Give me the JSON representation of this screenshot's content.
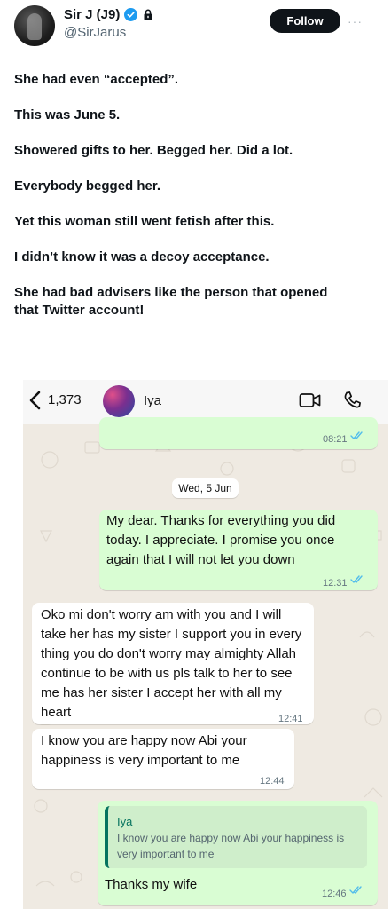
{
  "tweet": {
    "display_name": "Sir J (J9)",
    "handle": "@SirJarus",
    "follow_label": "Follow",
    "more_label": "···",
    "lines": [
      "She had even “accepted”.",
      "This was June 5.",
      "Showered gifts to her. Begged her. Did a lot.",
      "Everybody begged her.",
      "Yet this woman still went fetish after this.",
      "I didn’t know it was a decoy acceptance.",
      "She had bad advisers like the person that opened that Twitter account!"
    ]
  },
  "chat": {
    "back_count": "1,373",
    "contact_name": "Iya",
    "date_separator": "Wed, 5 Jun",
    "messages": [
      {
        "direction": "out",
        "text": "",
        "time": "08:21",
        "read": true
      },
      {
        "direction": "out",
        "text": "My dear. Thanks for everything you did today. I appreciate. I promise you once again that I will not let you down",
        "time": "12:31",
        "read": true
      },
      {
        "direction": "in",
        "text": "Oko mi don't worry am with you and I will take her has my sister I support you in every thing you do don't worry may almighty Allah continue to be with us pls talk to her to see me has her sister I accept her with all my heart",
        "time": "12:41"
      },
      {
        "direction": "in",
        "text": "I know you are happy now Abi your happiness is very important to me",
        "time": "12:44"
      },
      {
        "direction": "out",
        "quote_name": "Iya",
        "quote_text": "I know you are happy now Abi your happiness is very important to me",
        "text": "Thanks my wife",
        "time": "12:46",
        "read": true
      }
    ]
  },
  "colors": {
    "tweet_text": "#0f1419",
    "handle": "#536471",
    "verified_badge": "#1d9bf0",
    "chat_background": "#efeae2",
    "outgoing_bubble": "#d9fdd3",
    "incoming_bubble": "#ffffff",
    "read_ticks": "#53bdeb",
    "quote_accent": "#06735f"
  },
  "icons": [
    "verified-badge-icon",
    "lock-icon",
    "more-icon",
    "back-chevron-icon",
    "video-call-icon",
    "phone-icon",
    "double-check-icon"
  ]
}
